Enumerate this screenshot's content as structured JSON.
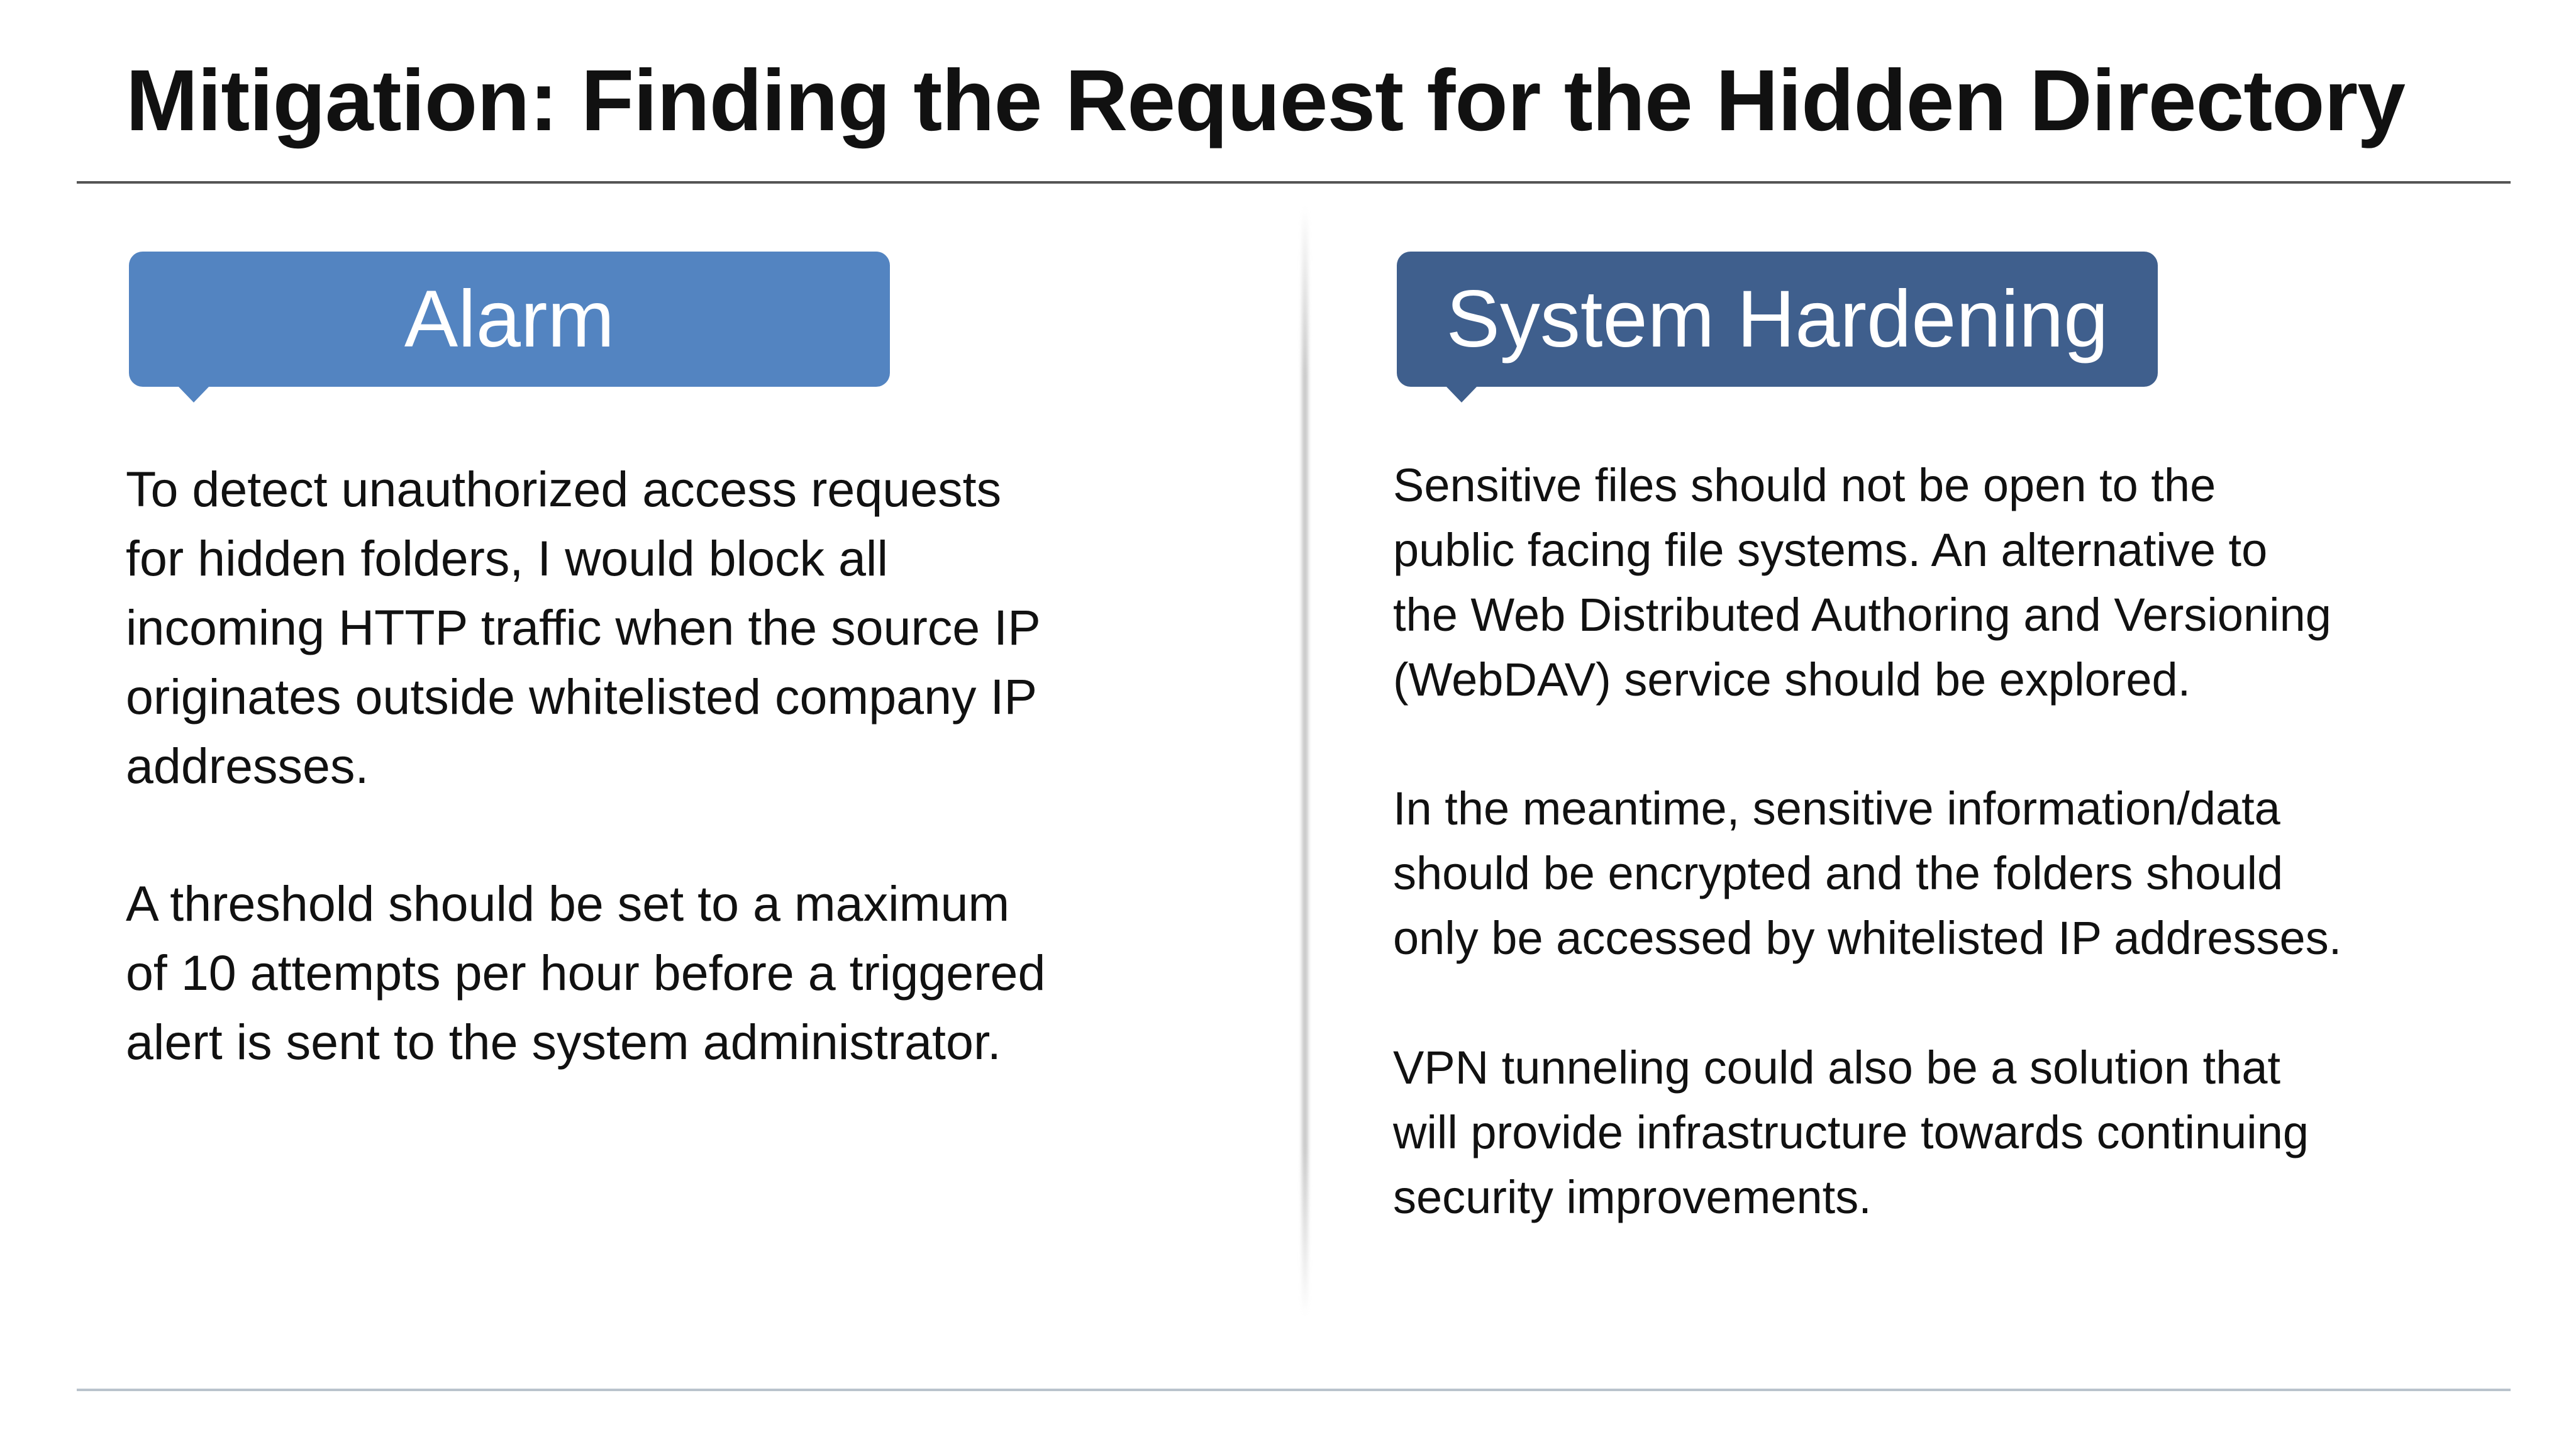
{
  "slide": {
    "title": "Mitigation: Finding the Request for the Hidden Directory"
  },
  "alarm": {
    "heading": "Alarm",
    "paragraphs": [
      {
        "lines": [
          "To detect unauthorized access requests",
          "for hidden folders, I would block all",
          "incoming HTTP traffic when the source IP",
          "originates outside whitelisted company IP",
          "addresses."
        ]
      },
      {
        "lines": [
          "A threshold should be set to a maximum",
          "of 10 attempts per hour before a triggered",
          "alert is sent to the system administrator."
        ]
      }
    ]
  },
  "hardening": {
    "heading": "System Hardening",
    "paragraphs": [
      {
        "lines": [
          "Sensitive files should not be open to the",
          "public facing file systems. An alternative to",
          "the Web Distributed Authoring and Versioning",
          "(WebDAV) service should be explored."
        ]
      },
      {
        "lines": [
          "In the meantime, sensitive information/data",
          "should be encrypted and the folders should",
          "only be accessed by whitelisted IP addresses."
        ]
      },
      {
        "lines": [
          "VPN tunneling could also be a solution that",
          "will provide infrastructure towards continuing",
          "security improvements."
        ]
      }
    ]
  },
  "colors": {
    "alarm_callout": "#5384c1",
    "hardening_callout": "#3f5f8d"
  }
}
